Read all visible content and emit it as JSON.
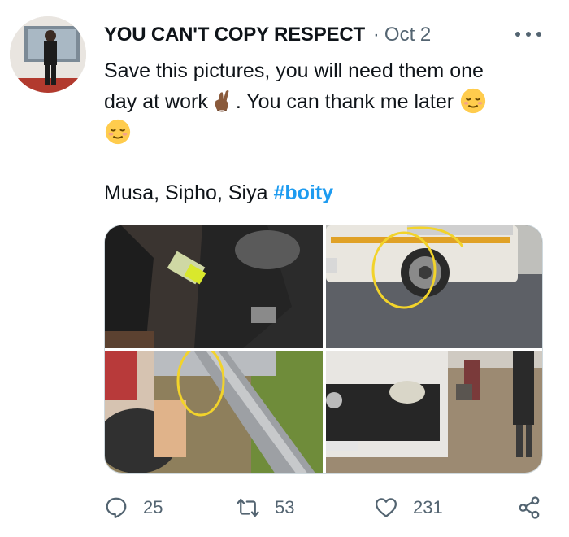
{
  "tweet": {
    "author_name": "YOU CAN'T COPY RESPECT",
    "separator": "·",
    "date": "Oct 2",
    "line1": "Save this pictures, you will need them one",
    "line2_a": "day at work",
    "line2_b": ". You can thank me later",
    "names": "Musa, Sipho, Siya ",
    "hashtag": "#boity"
  },
  "stats": {
    "replies": "25",
    "retweets": "53",
    "likes": "231"
  },
  "icons": {
    "more": "more-dots-icon",
    "reply": "reply-bubble-icon",
    "retweet": "retweet-icon",
    "like": "heart-icon",
    "share": "share-icon",
    "emoji_fingers": "crossed-fingers-emoji",
    "emoji_relieved": "relieved-face-emoji"
  },
  "colors": {
    "text": "#0f1419",
    "muted": "#536471",
    "link": "#1d9bf0",
    "highlight_circle": "#f2d32b"
  }
}
